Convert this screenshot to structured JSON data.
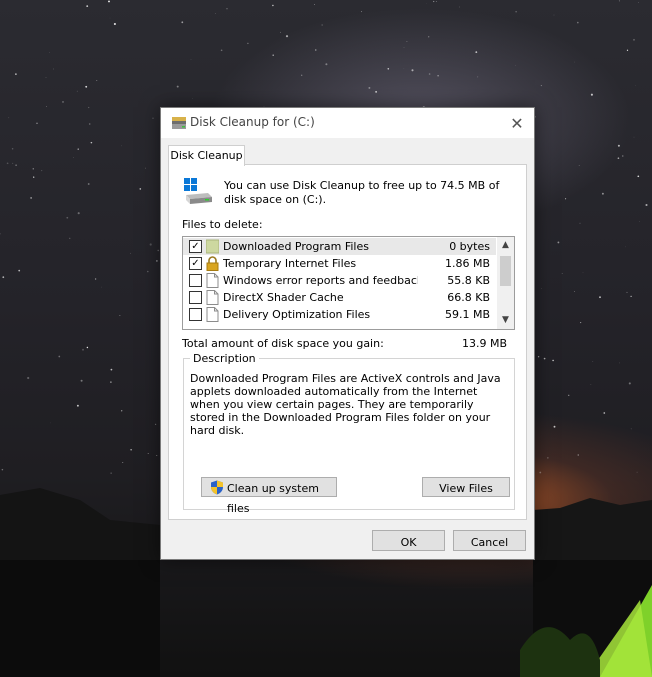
{
  "window": {
    "title": "Disk Cleanup for  (C:)",
    "close_glyph": "✕"
  },
  "tab": {
    "label": "Disk Cleanup"
  },
  "intro": {
    "text": "You can use Disk Cleanup to free up to 74.5 MB of disk space on  (C:)."
  },
  "files": {
    "label": "Files to delete:",
    "items": [
      {
        "name": "Downloaded Program Files",
        "size": "0 bytes",
        "checked": true,
        "icon": "folder-icon",
        "selected": true
      },
      {
        "name": "Temporary Internet Files",
        "size": "1.86 MB",
        "checked": true,
        "icon": "lock-icon",
        "selected": false
      },
      {
        "name": "Windows error reports and feedback di...",
        "size": "55.8 KB",
        "checked": false,
        "icon": "file-icon",
        "selected": false
      },
      {
        "name": "DirectX Shader Cache",
        "size": "66.8 KB",
        "checked": false,
        "icon": "file-icon",
        "selected": false
      },
      {
        "name": "Delivery Optimization Files",
        "size": "59.1 MB",
        "checked": false,
        "icon": "file-icon",
        "selected": false
      }
    ],
    "scroll_up_glyph": "▲",
    "scroll_down_glyph": "▼"
  },
  "total": {
    "label": "Total amount of disk space you gain:",
    "value": "13.9 MB"
  },
  "description": {
    "legend": "Description",
    "text": "Downloaded Program Files are ActiveX controls and Java applets downloaded automatically from the Internet when you view certain pages. They are temporarily stored in the Downloaded Program Files folder on your hard disk."
  },
  "buttons": {
    "cleanup_system": "Clean up system files",
    "view_files": "View Files",
    "ok": "OK",
    "cancel": "Cancel"
  },
  "colors": {
    "checkmark": "#000000",
    "windows_blue": "#0a78d7",
    "folder": "#cdd8a0",
    "lock": "#d9a520"
  }
}
